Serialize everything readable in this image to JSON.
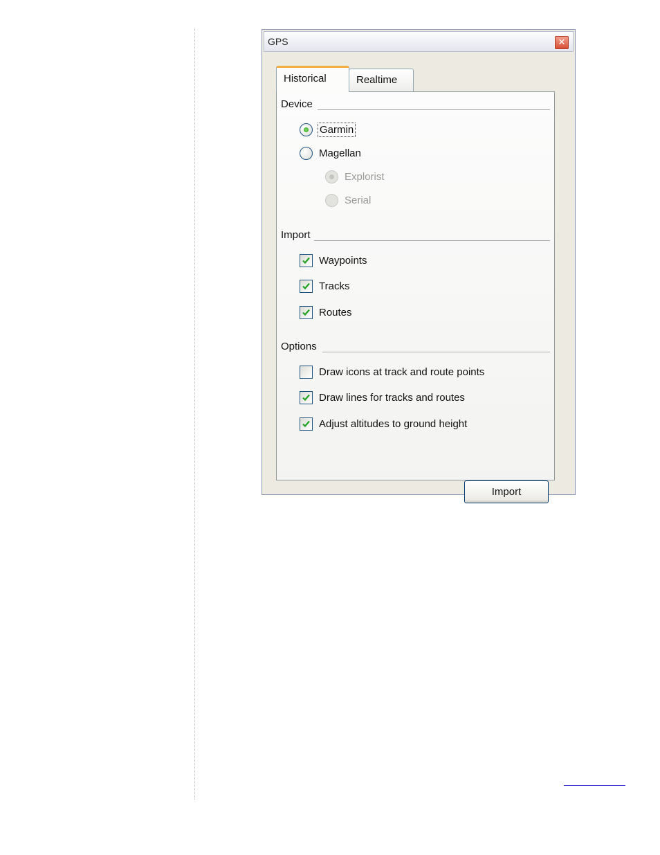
{
  "window": {
    "title": "GPS",
    "close_glyph": "✕"
  },
  "tabs": [
    {
      "label": "Historical",
      "active": true
    },
    {
      "label": "Realtime",
      "active": false
    }
  ],
  "device": {
    "label": "Device",
    "options": [
      {
        "label": "Garmin",
        "checked": true,
        "enabled": true
      },
      {
        "label": "Magellan",
        "checked": false,
        "enabled": true
      }
    ],
    "magellan_sub_options": [
      {
        "label": "Explorist",
        "checked": true,
        "enabled": false
      },
      {
        "label": "Serial",
        "checked": false,
        "enabled": false
      }
    ]
  },
  "import_section": {
    "label": "Import",
    "items": [
      {
        "label": "Waypoints",
        "checked": true
      },
      {
        "label": "Tracks",
        "checked": true
      },
      {
        "label": "Routes",
        "checked": true
      }
    ]
  },
  "options_section": {
    "label": "Options",
    "items": [
      {
        "label": "Draw icons at track and route points",
        "checked": false
      },
      {
        "label": "Draw lines for tracks and routes",
        "checked": true
      },
      {
        "label": "Adjust altitudes to ground height",
        "checked": true
      }
    ]
  },
  "import_button": {
    "label": "Import"
  },
  "icons": {
    "close": "close-icon",
    "check": "checkmark-icon"
  },
  "colors": {
    "check_green": "#21a121",
    "tab_highlight": "#f0b040",
    "control_border": "#1c5180",
    "close_red": "#d84f35"
  }
}
